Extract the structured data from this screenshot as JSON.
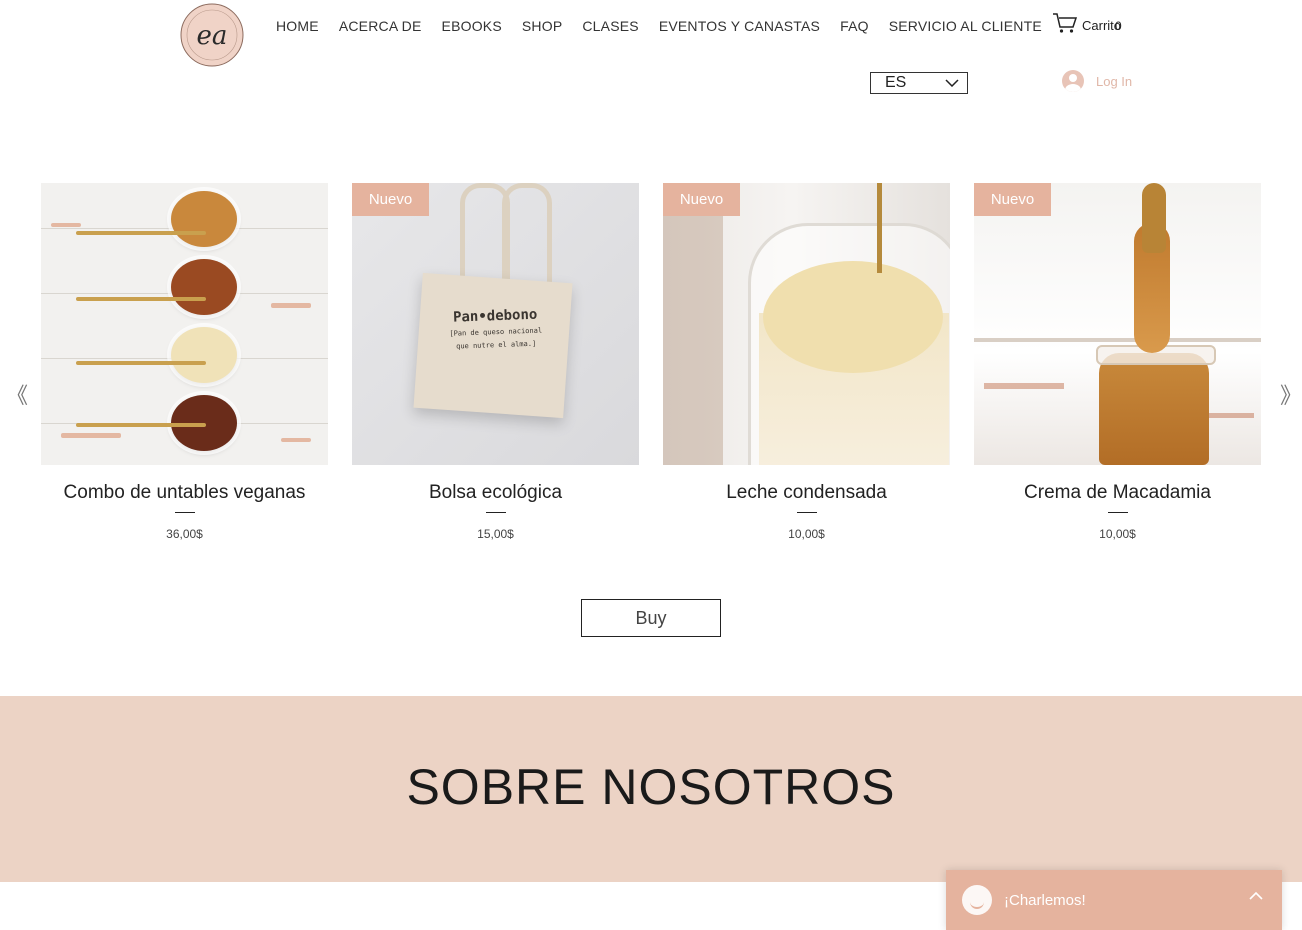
{
  "header": {
    "logo_text": "ea",
    "nav": [
      "HOME",
      "ACERCA DE",
      "EBOOKS",
      "SHOP",
      "CLASES",
      "EVENTOS Y CANASTAS",
      "FAQ",
      "SERVICIO AL CLIENTE"
    ],
    "cart_label": "Carrito",
    "cart_count": "0",
    "language": "ES",
    "login_label": "Log In"
  },
  "gallery": {
    "prev_icon": "chevron-left-icon",
    "next_icon": "chevron-right-icon",
    "products": [
      {
        "name": "Combo de untables veganas",
        "price": "36,00$",
        "badge": ""
      },
      {
        "name": "Bolsa ecológica",
        "price": "15,00$",
        "badge": "Nuevo"
      },
      {
        "name": "Leche condensada",
        "price": "10,00$",
        "badge": "Nuevo"
      },
      {
        "name": "Crema de Macadamia",
        "price": "10,00$",
        "badge": "Nuevo"
      }
    ],
    "bag_print": {
      "title": "Pan•debono",
      "line1": "[Pan de queso nacional",
      "line2": "que nutre el alma.]"
    }
  },
  "buy_label": "Buy",
  "about": {
    "title": "SOBRE NOSOTROS"
  },
  "chat": {
    "label": "¡Charlemos!"
  },
  "colors": {
    "accent": "#e5b39e",
    "about_bg": "#ecd3c5"
  }
}
